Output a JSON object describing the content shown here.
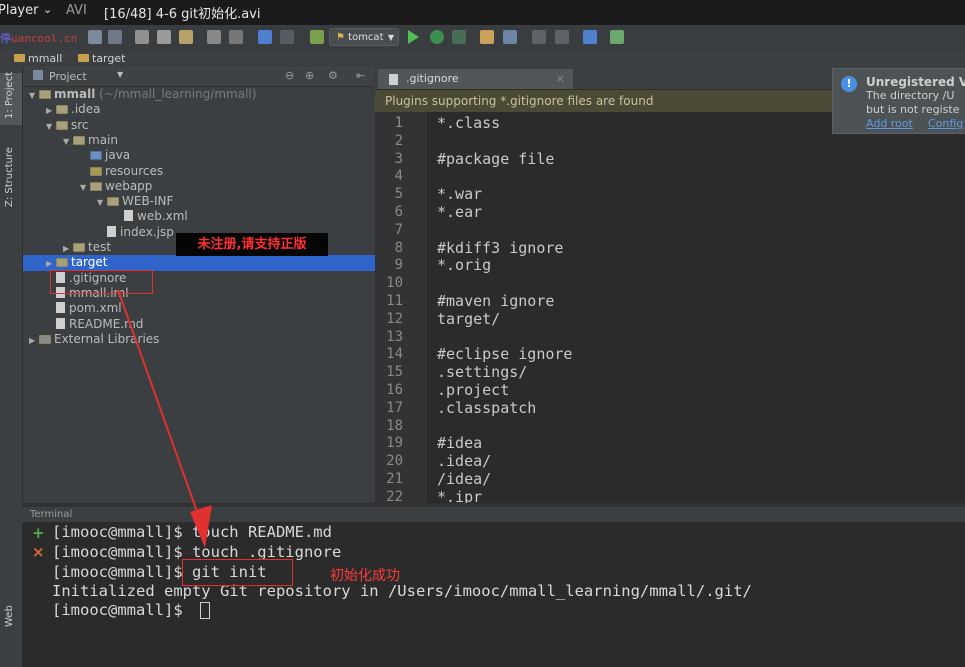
{
  "player": {
    "app": "Player",
    "dropdown_glyph": "⌄",
    "format": "AVI",
    "title": "[16/48] 4-6 git初始化.avi"
  },
  "watermark_site": "uancool.cn",
  "watermark_char": "停",
  "toolbar": {
    "run_config": "tomcat"
  },
  "navbar": {
    "items": [
      "mmall",
      "target"
    ]
  },
  "tool_windows": {
    "project": "1: Project",
    "structure": "Z: Structure",
    "web": "Web"
  },
  "project_panel": {
    "header": "Project",
    "tree": [
      {
        "label": "mmall",
        "note": "(~/mmall_learning/mmall)",
        "depth": 0,
        "arrow": "▼"
      },
      {
        "label": ".idea",
        "depth": 1,
        "arrow": "▶"
      },
      {
        "label": "src",
        "depth": 1,
        "arrow": "▼"
      },
      {
        "label": "main",
        "depth": 2,
        "arrow": "▼"
      },
      {
        "label": "java",
        "depth": 3,
        "arrow": ""
      },
      {
        "label": "resources",
        "depth": 3,
        "arrow": ""
      },
      {
        "label": "webapp",
        "depth": 3,
        "arrow": "▼"
      },
      {
        "label": "WEB-INF",
        "depth": 4,
        "arrow": "▼"
      },
      {
        "label": "web.xml",
        "depth": 5,
        "arrow": ""
      },
      {
        "label": "index.jsp",
        "depth": 4,
        "arrow": ""
      },
      {
        "label": "test",
        "depth": 2,
        "arrow": "▶"
      },
      {
        "label": "target",
        "depth": 1,
        "arrow": "▶"
      },
      {
        "label": ".gitignore",
        "depth": 1,
        "arrow": ""
      },
      {
        "label": "mmall.iml",
        "depth": 1,
        "arrow": ""
      },
      {
        "label": "pom.xml",
        "depth": 1,
        "arrow": ""
      },
      {
        "label": "README.md",
        "depth": 1,
        "arrow": ""
      },
      {
        "label": "External Libraries",
        "depth": 0,
        "arrow": "▶"
      }
    ]
  },
  "editor": {
    "tab": ".gitignore",
    "banner": "Plugins supporting *.gitignore files are found",
    "lines": [
      "*.class",
      "",
      "#package file",
      "",
      "*.war",
      "*.ear",
      "",
      "#kdiff3 ignore",
      "*.orig",
      "",
      "#maven ignore",
      "target/",
      "",
      "#eclipse ignore",
      ".settings/",
      ".project",
      ".classpatch",
      "",
      "#idea",
      ".idea/",
      "/idea/",
      "*.ipr"
    ]
  },
  "notification": {
    "title": "Unregistered V(",
    "line1": "The directory /U",
    "line2": "but is not registe",
    "link1": "Add root",
    "link2": "Config"
  },
  "overlay_banner": "未注册,请支持正版",
  "terminal": {
    "header": "Terminal",
    "lines": [
      "[imooc@mmall]$ touch README.md",
      "[imooc@mmall]$ touch .gitignore",
      "[imooc@mmall]$ git init",
      "Initialized empty Git repository in /Users/imooc/mmall_learning/mmall/.git/",
      "[imooc@mmall]$ "
    ],
    "add_symbol": "+",
    "close_symbol": "×"
  },
  "annotation": "初始化成功",
  "colors": {
    "selection": "#2f65ca",
    "annotation_red": "#e03030",
    "banner_bg": "#4b4a37"
  }
}
